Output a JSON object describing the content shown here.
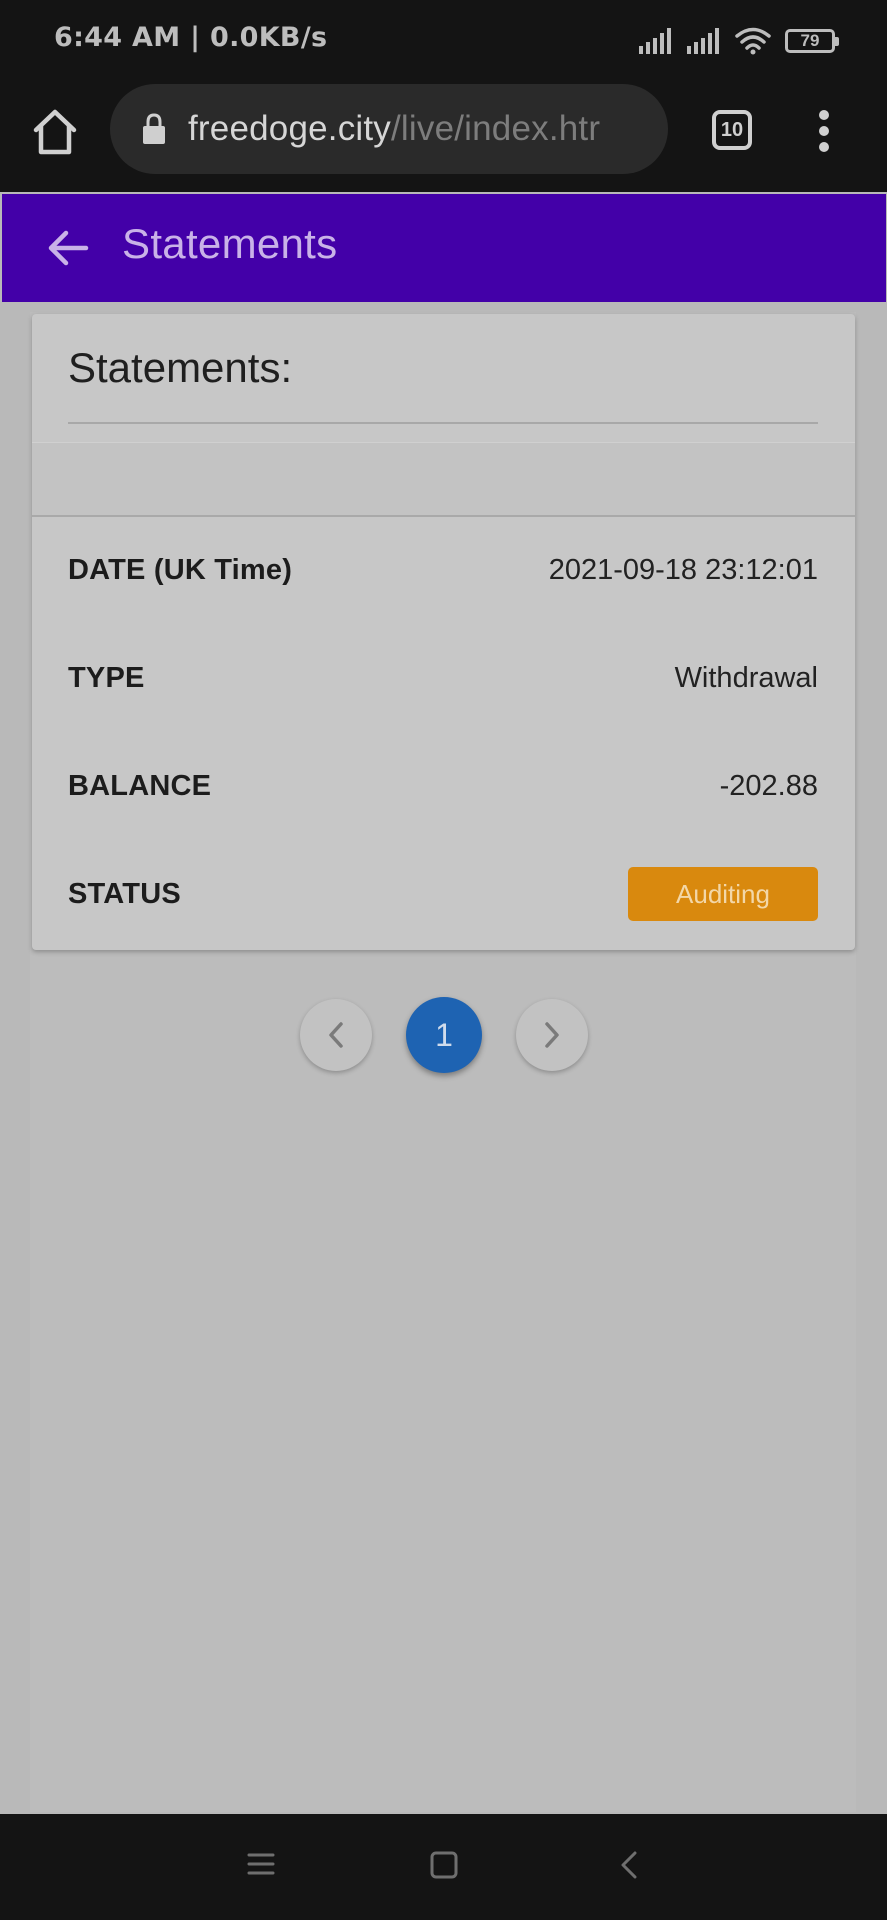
{
  "status_bar": {
    "time": "6:44 AM | 0.0KB/s",
    "battery": "79",
    "icons": [
      "signal-icon",
      "signal-icon",
      "wifi-icon",
      "battery-icon"
    ]
  },
  "browser": {
    "url_domain": "freedoge.city",
    "url_path": "/live/index.htr",
    "tab_count": "10",
    "icons": [
      "home-icon",
      "lock-icon",
      "tabs-icon",
      "more-vert-icon"
    ]
  },
  "header": {
    "title": "Statements",
    "back_icon": "arrow-left-icon",
    "color": "#4300a8"
  },
  "card": {
    "title": "Statements:",
    "rows": [
      {
        "label": "DATE (UK Time)",
        "value": "2021-09-18 23:12:01"
      },
      {
        "label": "TYPE",
        "value": "Withdrawal"
      },
      {
        "label": "BALANCE",
        "value": "-202.88"
      },
      {
        "label": "STATUS",
        "value": "Auditing"
      }
    ],
    "status_color": "#d9890e"
  },
  "pagination": {
    "current_page": "1",
    "prev_icon": "chevron-left-icon",
    "next_icon": "chevron-right-icon",
    "accent": "#1e63b2"
  },
  "nav_bar": {
    "icons": [
      "menu-icon",
      "square-icon",
      "back-chevron-icon"
    ]
  }
}
